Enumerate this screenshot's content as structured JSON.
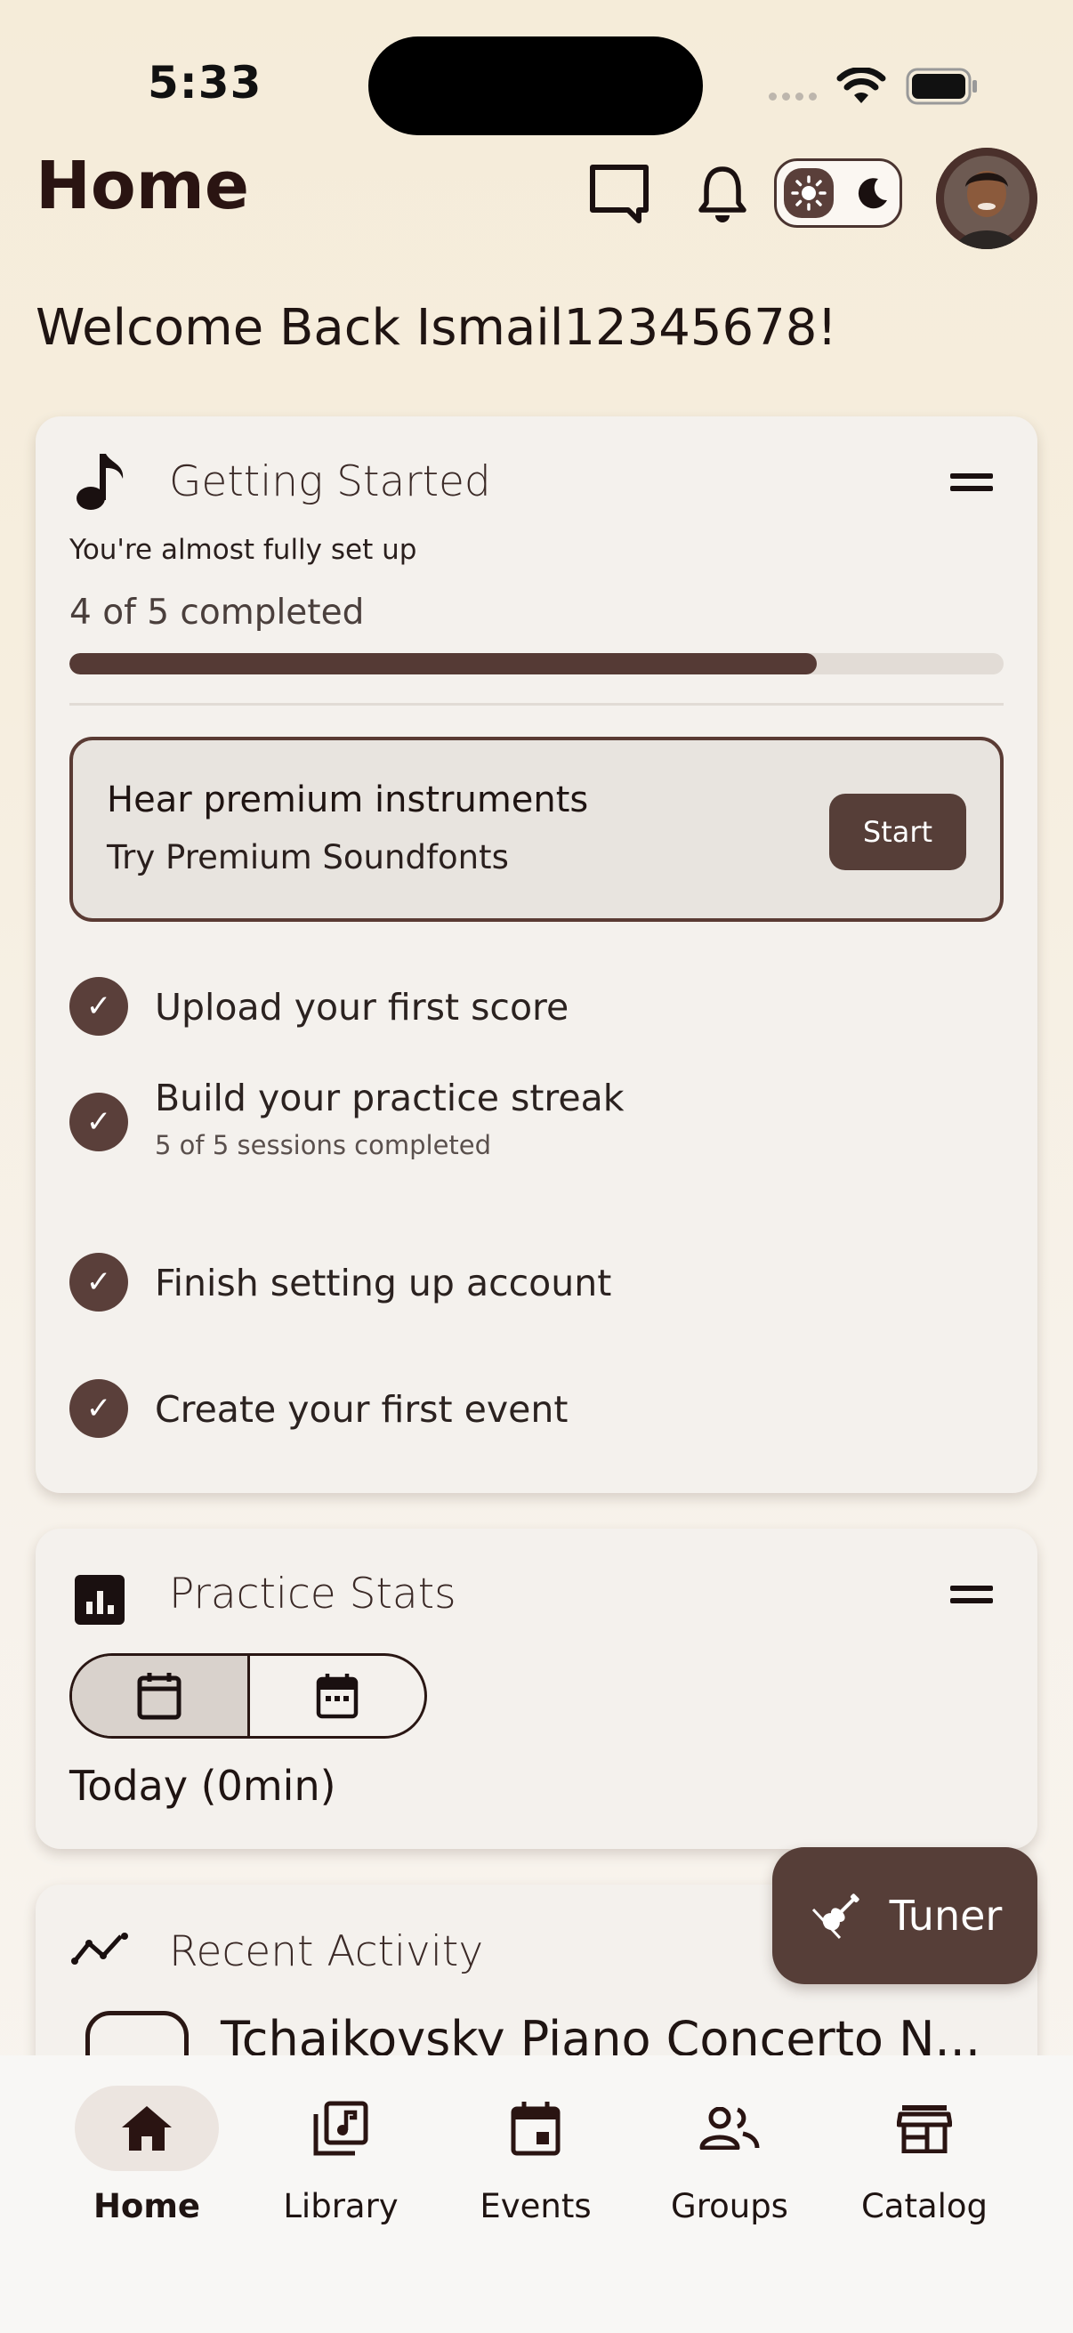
{
  "status_bar": {
    "time": "5:33"
  },
  "header": {
    "title": "Home"
  },
  "welcome": "Welcome Back Ismail12345678!",
  "getting_started": {
    "title": "Getting Started",
    "subtitle": "You're almost fully set up",
    "progress_text": "4 of 5 completed",
    "progress_fraction": 0.8,
    "promo": {
      "title": "Hear premium instruments",
      "subtitle": "Try Premium Soundfonts",
      "button": "Start"
    },
    "tasks": [
      {
        "label": "Upload your first score",
        "detail": "",
        "done": true
      },
      {
        "label": "Build your practice streak",
        "detail": "5 of 5 sessions completed",
        "done": true
      },
      {
        "label": "Finish setting up account",
        "detail": "",
        "done": true
      },
      {
        "label": "Create your first event",
        "detail": "",
        "done": true
      }
    ]
  },
  "practice_stats": {
    "title": "Practice Stats",
    "today": "Today (0min)"
  },
  "recent_activity": {
    "title": "Recent Activity",
    "item_title": "Tchaikovsky Piano Concerto N..."
  },
  "tuner": {
    "label": "Tuner"
  },
  "bottom_nav": [
    {
      "label": "Home",
      "icon": "home-icon",
      "active": true
    },
    {
      "label": "Library",
      "icon": "library-icon",
      "active": false
    },
    {
      "label": "Events",
      "icon": "calendar-icon",
      "active": false
    },
    {
      "label": "Groups",
      "icon": "groups-icon",
      "active": false
    },
    {
      "label": "Catalog",
      "icon": "store-icon",
      "active": false
    }
  ],
  "colors": {
    "accent": "#563e38",
    "background": "#f5ecd9",
    "card": "#f4f1ed"
  }
}
